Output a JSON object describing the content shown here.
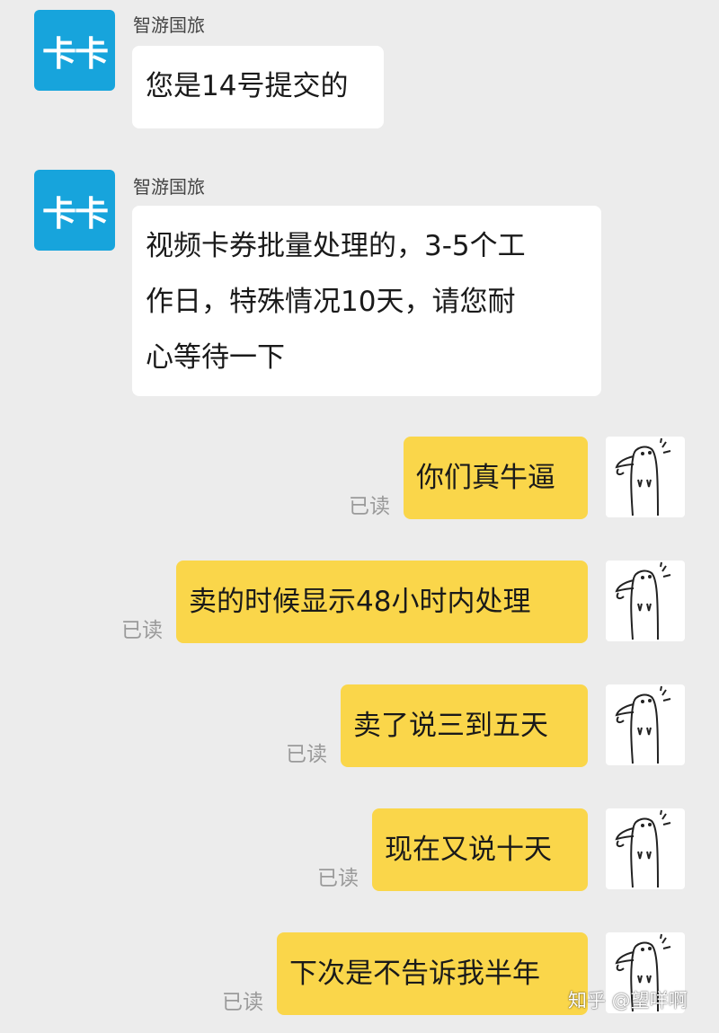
{
  "incoming": [
    {
      "avatar_text": "卡卡",
      "sender": "智游国旅",
      "text": "您是14号提交的"
    },
    {
      "avatar_text": "卡卡",
      "sender": "智游国旅",
      "lines": [
        "视频卡券批量处理的，3-5个工",
        "作日，特殊情况10天，请您耐",
        "心等待一下"
      ]
    }
  ],
  "outgoing": [
    {
      "text": "你们真牛逼",
      "status": "已读"
    },
    {
      "text": "卖的时候显示48小时内处理",
      "status": "已读"
    },
    {
      "text": "卖了说三到五天",
      "status": "已读"
    },
    {
      "text": "现在又说十天",
      "status": "已读"
    },
    {
      "text": "下次是不告诉我半年",
      "status": "已读"
    }
  ],
  "colors": {
    "background": "#ececec",
    "incoming_bubble": "#ffffff",
    "outgoing_bubble": "#fad64a",
    "shop_avatar": "#17a4dc"
  },
  "icons": {
    "user_avatar": "sketch-character-avatar"
  },
  "watermark": "知乎 @望咩啊"
}
